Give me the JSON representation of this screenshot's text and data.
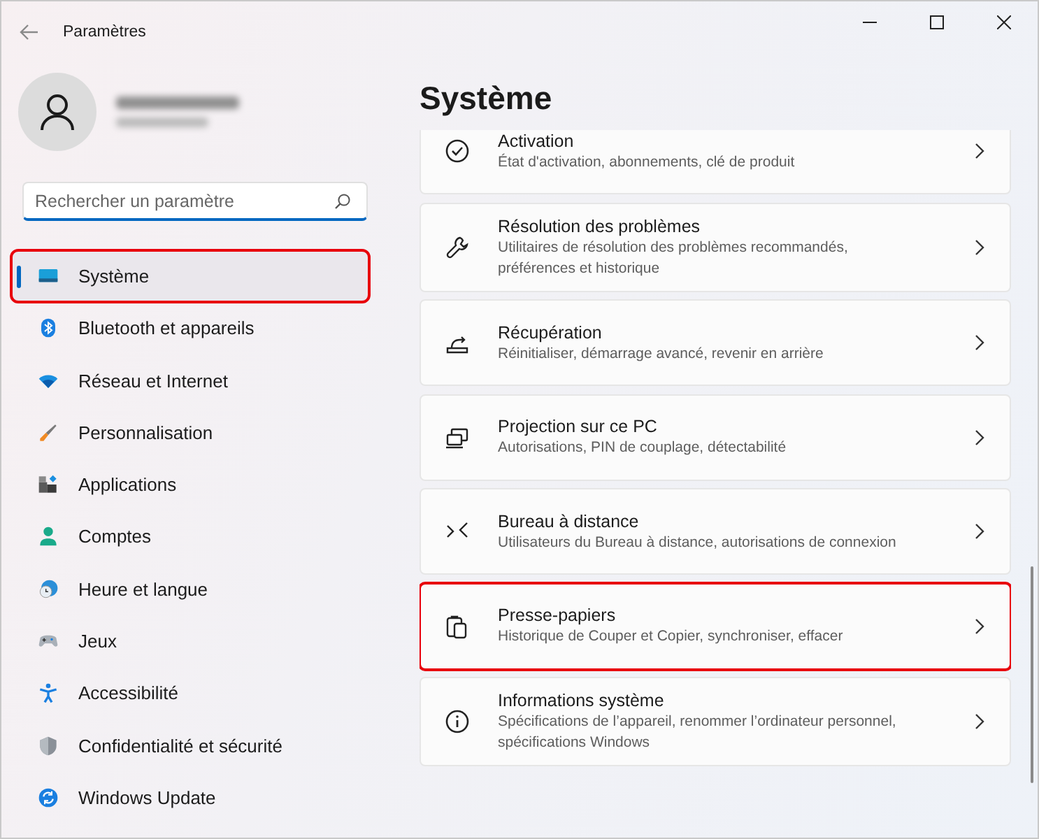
{
  "window": {
    "title": "Paramètres"
  },
  "search": {
    "placeholder": "Rechercher un paramètre"
  },
  "nav": [
    {
      "label": "Système",
      "selected": true,
      "highlighted": true
    },
    {
      "label": "Bluetooth et appareils",
      "selected": false,
      "highlighted": false
    },
    {
      "label": "Réseau et Internet",
      "selected": false,
      "highlighted": false
    },
    {
      "label": "Personnalisation",
      "selected": false,
      "highlighted": false
    },
    {
      "label": "Applications",
      "selected": false,
      "highlighted": false
    },
    {
      "label": "Comptes",
      "selected": false,
      "highlighted": false
    },
    {
      "label": "Heure et langue",
      "selected": false,
      "highlighted": false
    },
    {
      "label": "Jeux",
      "selected": false,
      "highlighted": false
    },
    {
      "label": "Accessibilité",
      "selected": false,
      "highlighted": false
    },
    {
      "label": "Confidentialité et sécurité",
      "selected": false,
      "highlighted": false
    },
    {
      "label": "Windows Update",
      "selected": false,
      "highlighted": false
    }
  ],
  "page": {
    "title": "Système"
  },
  "cards": [
    {
      "title": "Activation",
      "subtitle": "État d'activation, abonnements, clé de produit",
      "highlighted": false
    },
    {
      "title": "Résolution des problèmes",
      "subtitle": "Utilitaires de résolution des problèmes recommandés, préférences et historique",
      "highlighted": false
    },
    {
      "title": "Récupération",
      "subtitle": "Réinitialiser, démarrage avancé, revenir en arrière",
      "highlighted": false
    },
    {
      "title": "Projection sur ce PC",
      "subtitle": "Autorisations, PIN de couplage, détectabilité",
      "highlighted": false
    },
    {
      "title": "Bureau à distance",
      "subtitle": "Utilisateurs du Bureau à distance, autorisations de connexion",
      "highlighted": false
    },
    {
      "title": "Presse-papiers",
      "subtitle": "Historique de Couper et Copier, synchroniser, effacer",
      "highlighted": true
    },
    {
      "title": "Informations système",
      "subtitle": "Spécifications de l’appareil, renommer l’ordinateur personnel, spécifications Windows",
      "highlighted": false
    }
  ]
}
